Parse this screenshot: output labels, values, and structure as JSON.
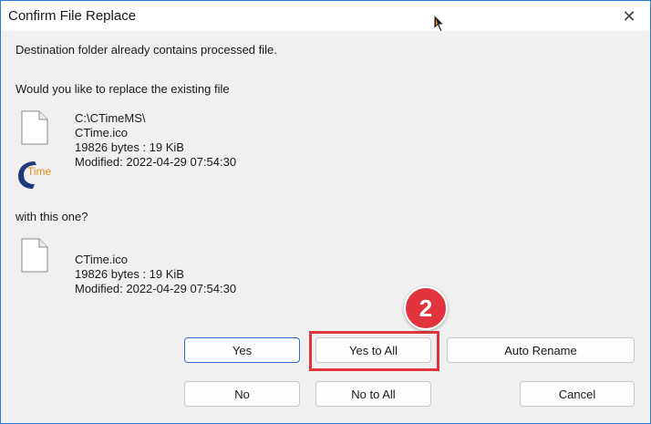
{
  "window": {
    "title": "Confirm File Replace",
    "close_glyph": "✕"
  },
  "message": {
    "line1": "Destination folder already contains processed file.",
    "question": "Would you like to replace the existing file",
    "with_this": "with this one?"
  },
  "existing_file": {
    "path": "C:\\CTimeMS\\",
    "name": "CTime.ico",
    "size": "19826 bytes : 19 KiB",
    "modified": "Modified: 2022-04-29 07:54:30",
    "logo_text": "Time"
  },
  "new_file": {
    "name": "CTime.ico",
    "size": "19826 bytes : 19 KiB",
    "modified": "Modified: 2022-04-29 07:54:30"
  },
  "buttons": {
    "yes": "Yes",
    "yes_to_all": "Yes to All",
    "auto_rename": "Auto Rename",
    "no": "No",
    "no_to_all": "No to All",
    "cancel": "Cancel"
  },
  "annotation": {
    "step_number": "2",
    "color": "#e0343f"
  },
  "colors": {
    "window_border": "#2b7bd6",
    "default_button_border": "#2d6fc8",
    "logo_orange": "#f08a1c",
    "logo_navy": "#1f3a7a"
  }
}
